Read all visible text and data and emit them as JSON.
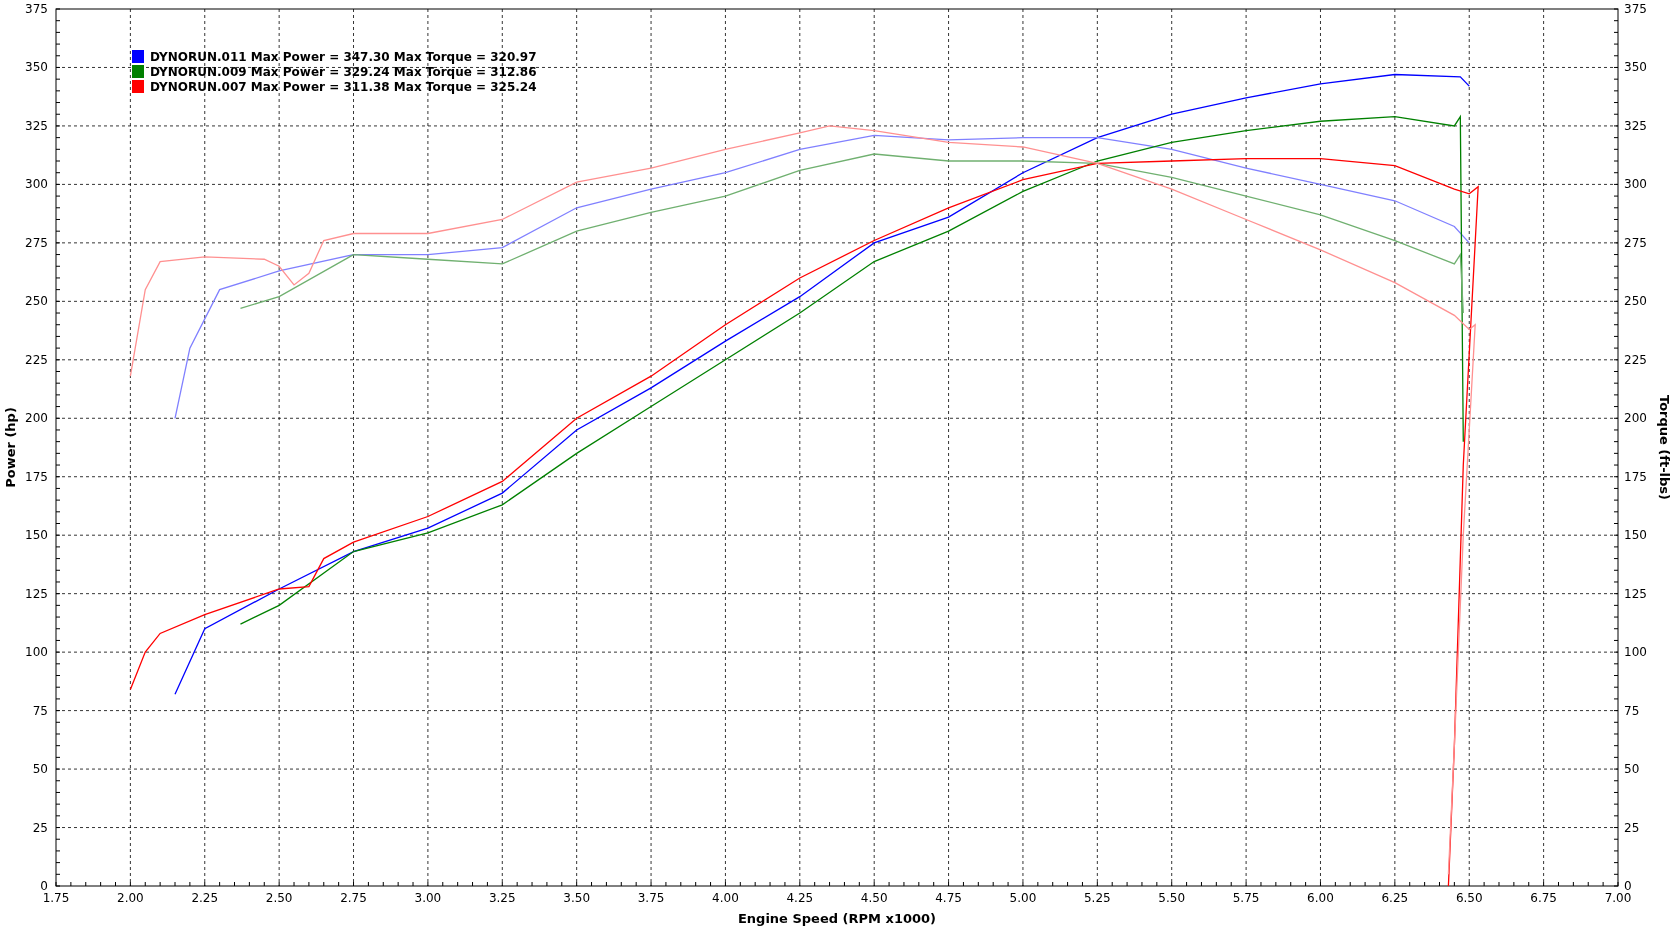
{
  "chart": {
    "legend": [
      {
        "text": "DYNORUN.011 Max Power = 347.30 Max Torque = 320.97",
        "color": "#0000ff"
      },
      {
        "text": "DYNORUN.009 Max Power = 329.24 Max Torque = 312.86",
        "color": "#008000"
      },
      {
        "text": "DYNORUN.007 Max Power = 311.38 Max Torque = 325.24",
        "color": "#ff0000"
      }
    ],
    "chart_data": {
      "type": "line",
      "xlabel": "Engine Speed (RPM x1000)",
      "ylabel": "Power (hp)",
      "y2label": "Torque (ft-lbs)",
      "xlim": [
        1.75,
        7
      ],
      "ylim": [
        0,
        375
      ],
      "y2lim": [
        0,
        375
      ],
      "grid": true,
      "xticks": [
        {
          "value": 1.75,
          "label": "1.75"
        },
        {
          "value": 2,
          "label": "2.00"
        },
        {
          "value": 2.25,
          "label": "2.25"
        },
        {
          "value": 2.5,
          "label": "2.50"
        },
        {
          "value": 2.75,
          "label": "2.75"
        },
        {
          "value": 3,
          "label": "3.00"
        },
        {
          "value": 3.25,
          "label": "3.25"
        },
        {
          "value": 3.5,
          "label": "3.50"
        },
        {
          "value": 3.75,
          "label": "3.75"
        },
        {
          "value": 4,
          "label": "4.00"
        },
        {
          "value": 4.25,
          "label": "4.25"
        },
        {
          "value": 4.5,
          "label": "4.50"
        },
        {
          "value": 4.75,
          "label": "4.75"
        },
        {
          "value": 5,
          "label": "5.00"
        },
        {
          "value": 5.25,
          "label": "5.25"
        },
        {
          "value": 5.5,
          "label": "5.50"
        },
        {
          "value": 5.75,
          "label": "5.75"
        },
        {
          "value": 6,
          "label": "6.00"
        },
        {
          "value": 6.25,
          "label": "6.25"
        },
        {
          "value": 6.5,
          "label": "6.50"
        },
        {
          "value": 6.75,
          "label": "6.75"
        },
        {
          "value": 7,
          "label": "7.00"
        }
      ],
      "yticks": [
        0,
        25,
        50,
        75,
        100,
        125,
        150,
        175,
        200,
        225,
        250,
        275,
        300,
        325,
        350,
        375
      ],
      "y2ticks": [
        0,
        25,
        50,
        75,
        100,
        125,
        150,
        175,
        200,
        225,
        250,
        275,
        300,
        325,
        350,
        375
      ],
      "series": [
        {
          "color": "#0000ff",
          "x": [
            2.15,
            2.25,
            2.5,
            2.75,
            3,
            3.25,
            3.5,
            3.75,
            4,
            4.25,
            4.5,
            4.75,
            5,
            5.25,
            5.5,
            5.75,
            6,
            6.25,
            6.47,
            6.5
          ],
          "values": [
            82,
            110,
            127,
            143,
            153,
            168,
            195,
            213,
            233,
            252,
            275,
            286,
            305,
            320,
            330,
            337,
            343,
            347,
            346,
            342
          ]
        },
        {
          "color": "#8080ff",
          "x": [
            2.15,
            2.2,
            2.3,
            2.5,
            2.75,
            3,
            3.25,
            3.5,
            3.75,
            4,
            4.25,
            4.5,
            4.75,
            5,
            5.25,
            5.5,
            5.75,
            6,
            6.25,
            6.45,
            6.5
          ],
          "values": [
            200,
            230,
            255,
            263,
            270,
            270,
            273,
            290,
            298,
            305,
            315,
            321,
            319,
            320,
            320,
            315,
            307,
            300,
            293,
            282,
            275
          ]
        },
        {
          "color": "#008000",
          "x": [
            2.37,
            2.5,
            2.75,
            3,
            3.25,
            3.5,
            3.75,
            4,
            4.25,
            4.5,
            4.75,
            5,
            5.25,
            5.5,
            5.75,
            6,
            6.25,
            6.45,
            6.47,
            6.48
          ],
          "values": [
            112,
            120,
            143,
            151,
            163,
            185,
            205,
            225,
            245,
            267,
            280,
            297,
            310,
            318,
            323,
            327,
            329,
            325,
            329,
            190
          ]
        },
        {
          "color": "#70b070",
          "x": [
            2.37,
            2.5,
            2.75,
            3,
            3.25,
            3.5,
            3.75,
            4,
            4.25,
            4.5,
            4.75,
            5,
            5.25,
            5.5,
            5.75,
            6,
            6.25,
            6.45,
            6.47,
            6.48
          ],
          "values": [
            247,
            252,
            270,
            268,
            266,
            280,
            288,
            295,
            306,
            313,
            310,
            310,
            309,
            303,
            295,
            287,
            276,
            266,
            270,
            245
          ]
        },
        {
          "color": "#ff0000",
          "x": [
            2,
            2.05,
            2.1,
            2.25,
            2.5,
            2.6,
            2.65,
            2.75,
            3,
            3.25,
            3.5,
            3.75,
            4,
            4.25,
            4.5,
            4.75,
            5,
            5.25,
            5.5,
            5.75,
            6,
            6.25,
            6.45,
            6.5,
            6.53,
            6.48,
            6.45,
            6.43
          ],
          "values": [
            84,
            100,
            108,
            116,
            127,
            128,
            140,
            147,
            158,
            173,
            200,
            218,
            240,
            260,
            276,
            290,
            302,
            309,
            310,
            311,
            311,
            308,
            298,
            296,
            299,
            180,
            60,
            0
          ]
        },
        {
          "color": "#ff9090",
          "x": [
            2,
            2.05,
            2.1,
            2.25,
            2.45,
            2.5,
            2.55,
            2.6,
            2.65,
            2.75,
            3,
            3.25,
            3.5,
            3.75,
            4,
            4.25,
            4.35,
            4.5,
            4.75,
            5,
            5.25,
            5.5,
            5.75,
            6,
            6.25,
            6.45,
            6.5,
            6.52,
            6.48,
            6.45,
            6.43
          ],
          "values": [
            218,
            255,
            267,
            269,
            268,
            265,
            257,
            262,
            276,
            279,
            279,
            285,
            301,
            307,
            315,
            322,
            325,
            323,
            318,
            316,
            309,
            298,
            285,
            272,
            258,
            244,
            238,
            240,
            150,
            60,
            5
          ]
        }
      ]
    }
  }
}
